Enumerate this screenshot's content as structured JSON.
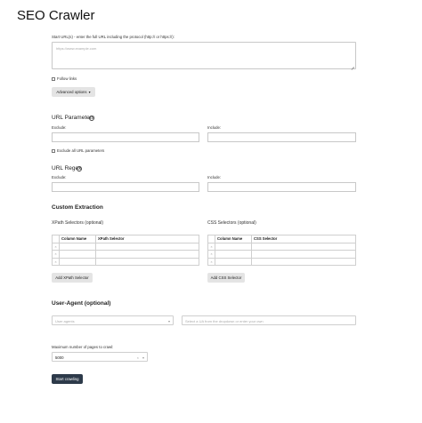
{
  "page": {
    "title": "SEO Crawler"
  },
  "start_urls": {
    "label": "Start URL(s) - enter the full URL including the protocol (http:// or https://):",
    "placeholder": "https://www.example.com"
  },
  "follow_links": {
    "label": "Follow links",
    "checked": false
  },
  "advanced_options": {
    "label": "Advanced options",
    "icon": "chevron-down-icon"
  },
  "url_parameters": {
    "heading": "URL Parameters",
    "help_icon": "?",
    "exclude_label": "Exclude:",
    "include_label": "Include:",
    "exclude_all_label": "Exclude all URL parameters"
  },
  "url_regex": {
    "heading": "URL Regex",
    "help_icon": "?",
    "exclude_label": "Exclude:",
    "include_label": "Include:"
  },
  "custom_extraction": {
    "heading": "Custom Extraction",
    "xpath": {
      "heading": "XPath Selectors (optional)",
      "columns": [
        "Column Name",
        "XPath Selector"
      ],
      "rows": [
        "×",
        "×",
        "×"
      ],
      "add_label": "Add XPath Selector"
    },
    "css": {
      "heading": "CSS Selectors (optional)",
      "columns": [
        "Column Name",
        "CSS Selector"
      ],
      "rows": [
        "×",
        "×",
        "×"
      ],
      "add_label": "Add CSS Selector"
    }
  },
  "user_agent": {
    "heading": "User-Agent (optional)",
    "select_placeholder": "User agents",
    "custom_placeholder": "Select a UA from the dropdown or enter your own"
  },
  "max_pages": {
    "label": "Maximum number of pages to crawl:",
    "value": "5000",
    "clear_icon": "×"
  },
  "start_button": {
    "label": "Start crawling"
  }
}
